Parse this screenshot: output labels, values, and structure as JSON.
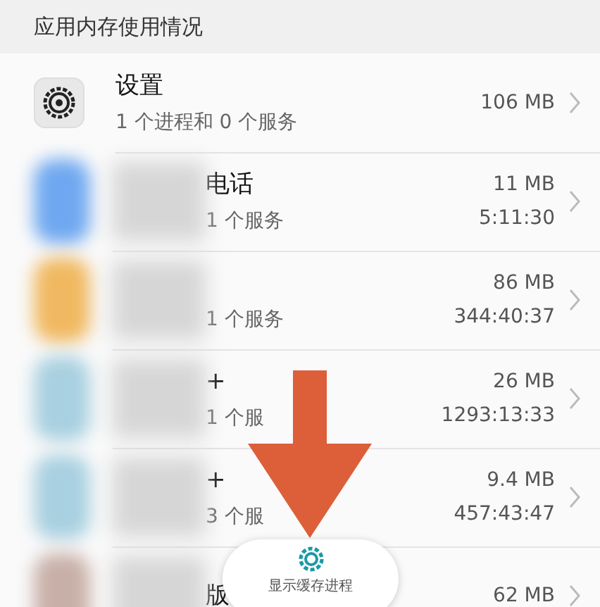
{
  "section_title": "应用内存使用情况",
  "apps": [
    {
      "kind": "settings",
      "name": "设置",
      "subtitle": "1 个进程和 0 个服务",
      "size": "106 MB"
    },
    {
      "kind": "blurred",
      "color": "#6fa8f0",
      "name": "电话",
      "subtitle": "1 个服务",
      "size": "11 MB",
      "runtime": "5:11:30"
    },
    {
      "kind": "blurred",
      "color": "#f0b860",
      "subtitle": "1 个服务",
      "size": "86 MB",
      "runtime": "344:40:37"
    },
    {
      "kind": "blurred",
      "color": "#a8d0e0",
      "name": "+",
      "subtitle": "1 个服",
      "size": "26 MB",
      "runtime": "1293:13:33"
    },
    {
      "kind": "blurred",
      "color": "#a8d0e0",
      "name": "+",
      "subtitle": "3 个服",
      "size": "9.4 MB",
      "runtime": "457:43:47"
    },
    {
      "kind": "blurred",
      "color": "#c8b0a8",
      "name": "版",
      "size": "62 MB"
    }
  ],
  "floating_button": {
    "label": "显示缓存进程"
  }
}
